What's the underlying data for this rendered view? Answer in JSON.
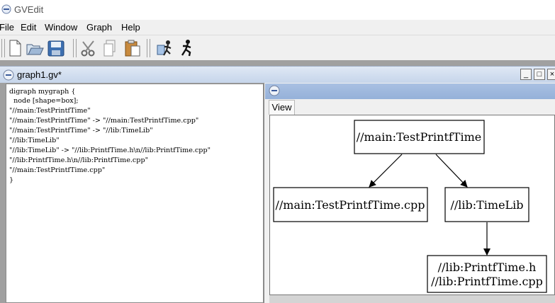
{
  "window": {
    "title": "GVEdit"
  },
  "menu": {
    "items": [
      "File",
      "Edit",
      "Window",
      "Graph",
      "Help"
    ]
  },
  "toolbar": {
    "buttons": [
      {
        "name": "new-file",
        "icon": "new-file-icon"
      },
      {
        "name": "open-file",
        "icon": "folder-open-icon"
      },
      {
        "name": "save-file",
        "icon": "floppy-disk-icon"
      },
      {
        "name": "cut",
        "icon": "scissors-icon"
      },
      {
        "name": "copy",
        "icon": "copy-icon"
      },
      {
        "name": "paste",
        "icon": "paste-icon"
      },
      {
        "name": "settings",
        "icon": "settings-runner-icon"
      },
      {
        "name": "run",
        "icon": "running-man-icon"
      }
    ]
  },
  "document": {
    "title": "graph1.gv*",
    "buttons": {
      "minimize": "_",
      "maximize": "□",
      "close": "×"
    },
    "code_lines": [
      "digraph mygraph {",
      "  node [shape=box];",
      "\"//main:TestPrintfTime\"",
      "\"//main:TestPrintfTime\" -> \"//main:TestPrintfTime.cpp\"",
      "\"//main:TestPrintfTime\" -> \"//lib:TimeLib\"",
      "\"//lib:TimeLib\"",
      "\"//lib:TimeLib\" -> \"//lib:PrintfTime.h\\n//lib:PrintfTime.cpp\"",
      "\"//lib:PrintfTime.h\\n//lib:PrintfTime.cpp\"",
      "\"//main:TestPrintfTime.cpp\"",
      "}"
    ]
  },
  "preview": {
    "tab_label": "View",
    "nodes": {
      "root": "//main:TestPrintfTime",
      "cpp": "//main:TestPrintfTime.cpp",
      "timelib": "//lib:TimeLib",
      "printf_line1": "//lib:PrintfTime.h",
      "printf_line2": "//lib:PrintfTime.cpp"
    }
  }
}
